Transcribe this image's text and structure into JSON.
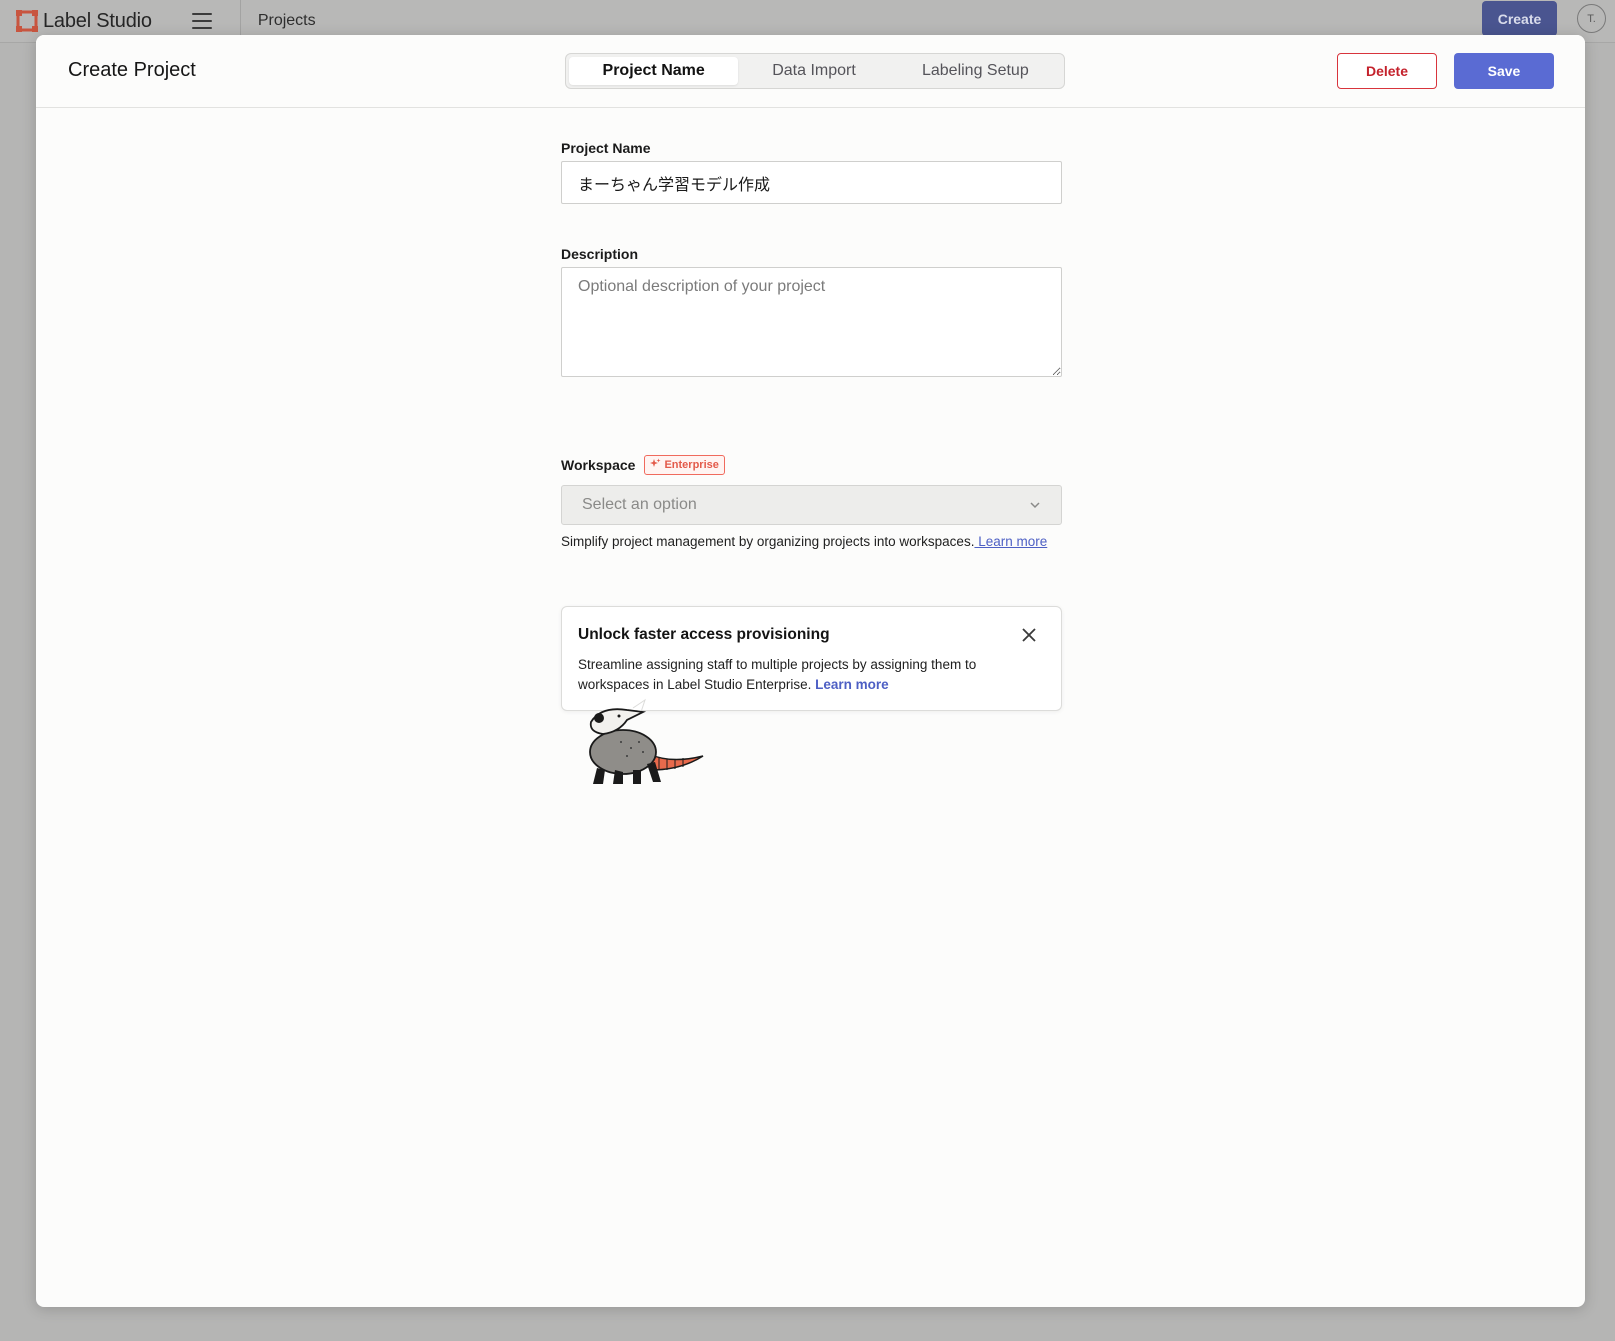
{
  "app": {
    "logo_text": "Label Studio",
    "breadcrumb": "Projects",
    "create_label": "Create",
    "avatar_initials": "T."
  },
  "modal": {
    "title": "Create Project",
    "tabs": [
      {
        "label": "Project Name",
        "active": true
      },
      {
        "label": "Data Import",
        "active": false
      },
      {
        "label": "Labeling Setup",
        "active": false
      }
    ],
    "delete_label": "Delete",
    "save_label": "Save"
  },
  "form": {
    "name_label": "Project Name",
    "name_value": "まーちゃん学習モデル作成",
    "description_label": "Description",
    "description_placeholder": "Optional description of your project",
    "description_value": "",
    "workspace_label": "Workspace",
    "enterprise_badge": "Enterprise",
    "workspace_placeholder": "Select an option",
    "workspace_help": "Simplify project management by organizing projects into workspaces.",
    "workspace_help_link": " Learn more"
  },
  "promo": {
    "title": "Unlock faster access provisioning",
    "body": "Streamline assigning staff to multiple projects by assigning them to workspaces in Label Studio Enterprise.",
    "link": "Learn more"
  },
  "colors": {
    "accent": "#5a6bd3",
    "danger": "#d8343c",
    "enterprise": "#f06a5d",
    "brand": "#e6513f"
  },
  "icons": [
    "label-studio-logo-icon",
    "hamburger-menu-icon",
    "sparkle-icon",
    "chevron-down-icon",
    "close-icon",
    "opossum-mascot"
  ]
}
